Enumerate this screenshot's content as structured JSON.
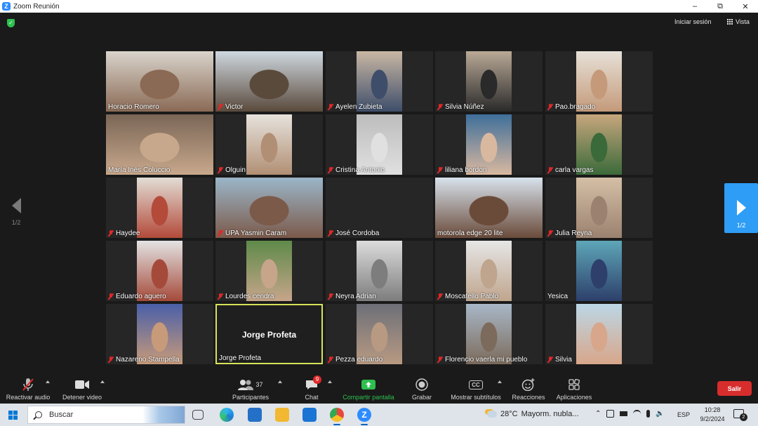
{
  "window": {
    "title": "Zoom Reunión"
  },
  "header": {
    "signin_label": "Iniciar sesión",
    "view_label": "Vista"
  },
  "pagination": {
    "prev_label": "1/2",
    "next_label": "1/2"
  },
  "participants": [
    {
      "name": "Horacio Romero",
      "muted": false,
      "video": true
    },
    {
      "name": "Victor",
      "muted": true,
      "video": true
    },
    {
      "name": "Ayelen Zubieta",
      "muted": true,
      "video": true
    },
    {
      "name": "Silvia Núñez",
      "muted": true,
      "video": true
    },
    {
      "name": "Pao.bragado",
      "muted": true,
      "video": true
    },
    {
      "name": "María Inés Coluccio",
      "muted": false,
      "video": true
    },
    {
      "name": "Olguin",
      "muted": true,
      "video": true
    },
    {
      "name": "Cristina Antonio",
      "muted": true,
      "video": true
    },
    {
      "name": "liliana bordon",
      "muted": true,
      "video": true
    },
    {
      "name": "carla vargas",
      "muted": true,
      "video": true
    },
    {
      "name": "Haydee",
      "muted": true,
      "video": true
    },
    {
      "name": "UPA Yasmin Caram",
      "muted": true,
      "video": true
    },
    {
      "name": "José Cordoba",
      "muted": true,
      "video": false
    },
    {
      "name": "motorola edge 20 lite",
      "muted": false,
      "video": true
    },
    {
      "name": "Julia Reyna",
      "muted": true,
      "video": true
    },
    {
      "name": "Eduardo aguero",
      "muted": true,
      "video": true
    },
    {
      "name": "Lourdes cendra",
      "muted": true,
      "video": true
    },
    {
      "name": "Neyra Adrian",
      "muted": true,
      "video": true
    },
    {
      "name": "Moscatello Pablo",
      "muted": true,
      "video": true
    },
    {
      "name": "Yesica",
      "muted": false,
      "video": true
    },
    {
      "name": "Nazareno Stampella",
      "muted": true,
      "video": true
    },
    {
      "name": "Jorge Profeta",
      "muted": false,
      "video": false,
      "active_speaker": true
    },
    {
      "name": "Pezza eduardo",
      "muted": true,
      "video": true
    },
    {
      "name": "Florencio vaerla mi pueblo",
      "muted": true,
      "video": true
    },
    {
      "name": "Silvia",
      "muted": true,
      "video": true
    }
  ],
  "active_speaker_display": "Jorge Profeta",
  "toolbar": {
    "unmute_label": "Reactivar audio",
    "stop_video_label": "Detener video",
    "participants_label": "Participantes",
    "participants_count": "37",
    "chat_label": "Chat",
    "chat_badge": "9",
    "share_label": "Compartir pantalla",
    "record_label": "Grabar",
    "captions_label": "Mostrar subtítulos",
    "captions_icon_text": "CC",
    "reactions_label": "Reacciones",
    "apps_label": "Aplicaciones",
    "leave_label": "Salir"
  },
  "taskbar": {
    "search_placeholder": "Buscar",
    "weather_temp": "28°C",
    "weather_desc": "Mayorm. nubla...",
    "language": "ESP",
    "time": "10:28",
    "date": "9/2/2024",
    "notifications": "2"
  },
  "colors": {
    "accent_blue": "#2e9df5",
    "leave_red": "#d72d2d",
    "muted_red": "#e02828",
    "active_border": "#d6e35a",
    "share_green": "#2ec04f"
  }
}
